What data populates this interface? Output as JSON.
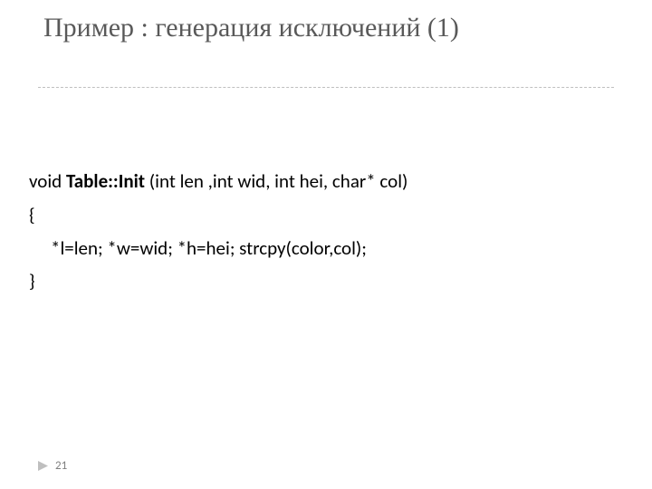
{
  "title": "Пример : генерация исключений (1)",
  "code": {
    "line1_prefix": "void ",
    "line1_bold": "Table::Init ",
    "line1_suffix": "(int len ,int wid, int hei, char* col)",
    "line2": "{",
    "line3": "*l=len; *w=wid; *h=hei; strcpy(color,col);",
    "line4": "}"
  },
  "footer": {
    "page": "21"
  }
}
